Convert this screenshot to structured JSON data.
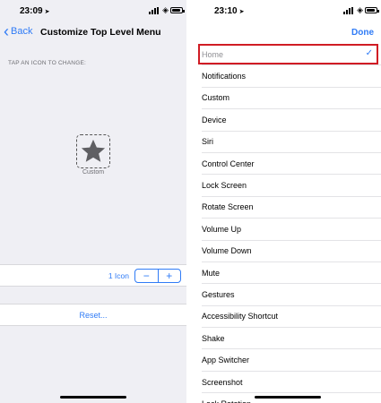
{
  "left_screen": {
    "status": {
      "time": "23:09"
    },
    "nav": {
      "back_label": "Back",
      "title": "Customize Top Level Menu"
    },
    "section_header": "TAP AN ICON TO CHANGE:",
    "icon": {
      "name": "star-icon",
      "label": "Custom"
    },
    "stepper": {
      "count_label": "1 Icon",
      "minus": "−",
      "plus": "+"
    },
    "reset_label": "Reset..."
  },
  "right_screen": {
    "status": {
      "time": "23:10"
    },
    "nav": {
      "done_label": "Done"
    },
    "selected_item": "Home",
    "items": [
      "Home",
      "Notifications",
      "Custom",
      "Device",
      "Siri",
      "Control Center",
      "Lock Screen",
      "Rotate Screen",
      "Volume Up",
      "Volume Down",
      "Mute",
      "Gestures",
      "Accessibility Shortcut",
      "Shake",
      "App Switcher",
      "Screenshot",
      "Lock Rotation"
    ]
  },
  "colors": {
    "accent": "#2f7bf6",
    "highlight": "#d01c24",
    "background": "#efeff4"
  }
}
